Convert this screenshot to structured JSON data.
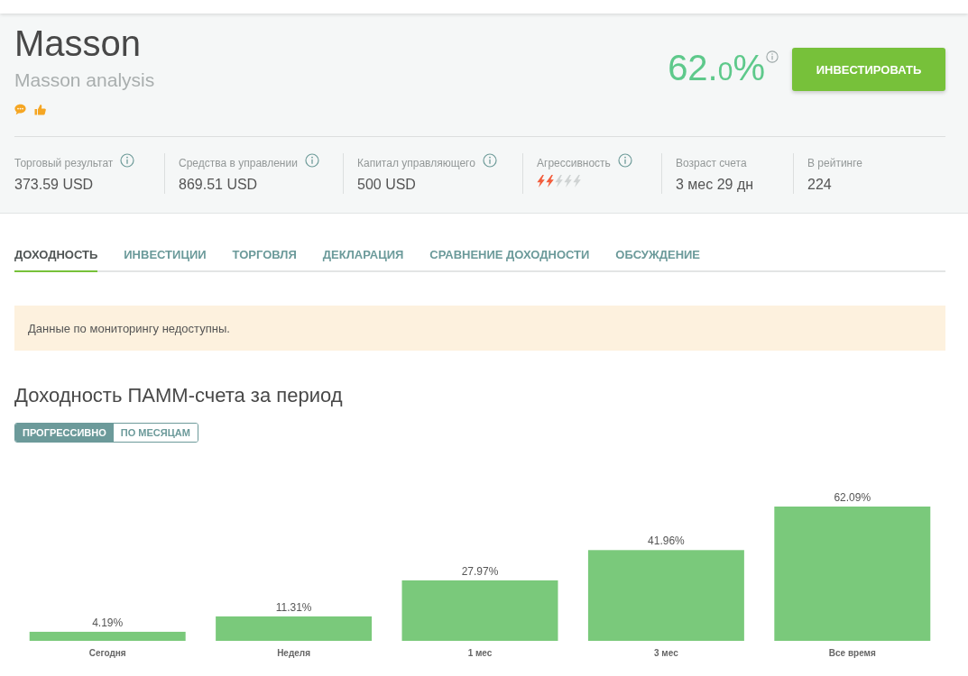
{
  "header": {
    "title": "Masson",
    "subtitle": "Masson analysis",
    "yield": {
      "main": "62.",
      "fraction": "0",
      "unit": "%"
    },
    "invest_button": "ИНВЕСТИРОВАТЬ"
  },
  "stats": [
    {
      "kind": "value",
      "label": "Торговый результат",
      "value": "373.59 USD",
      "info": true
    },
    {
      "kind": "value",
      "label": "Средства в управлении",
      "value": "869.51 USD",
      "info": true
    },
    {
      "kind": "value",
      "label": "Капитал управляющего",
      "value": "500 USD",
      "info": true
    },
    {
      "kind": "rating",
      "label": "Агрессивность",
      "stars": 2,
      "info": true
    },
    {
      "kind": "value",
      "label": "Возраст счета",
      "value": "3 мес 29 дн",
      "info": false
    },
    {
      "kind": "value",
      "label": "В рейтинге",
      "value": "224",
      "info": false
    }
  ],
  "tabs": [
    {
      "label": "ДОХОДНОСТЬ",
      "selected": true
    },
    {
      "label": "ИНВЕСТИЦИИ",
      "selected": false
    },
    {
      "label": "ТОРГОВЛЯ",
      "selected": false
    },
    {
      "label": "ДЕКЛАРАЦИЯ",
      "selected": false
    },
    {
      "label": "СРАВНЕНИЕ ДОХОДНОСТИ",
      "selected": false
    },
    {
      "label": "ОБСУЖДЕНИЕ",
      "selected": false
    }
  ],
  "notice": "Данные по мониторингу недоступны.",
  "yield_section": {
    "title": "Доходность ПАММ-счета за период",
    "toggle": [
      {
        "label": "ПРОГРЕССИВНО",
        "selected": true
      },
      {
        "label": "ПО МЕСЯЦАМ",
        "selected": false
      }
    ],
    "chart_data": {
      "type": "bar",
      "categories": [
        "Сегодня",
        "Неделя",
        "1 мес",
        "3 мес",
        "Все время"
      ],
      "values": [
        4.19,
        11.31,
        27.97,
        41.96,
        62.09
      ],
      "value_labels": [
        "4.19%",
        "11.31%",
        "27.97%",
        "41.96%",
        "62.09%"
      ],
      "color": "#7ac97b"
    }
  }
}
